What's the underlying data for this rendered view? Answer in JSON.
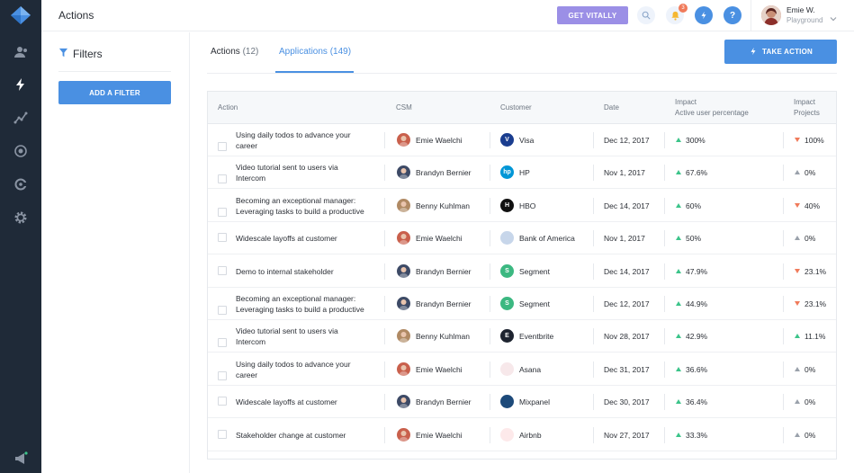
{
  "header": {
    "title": "Actions",
    "get_vitally": "GET VITALLY",
    "notification_count": "3",
    "user": {
      "name": "Emie W.",
      "org": "Playground"
    }
  },
  "nav_icons": [
    "logo-icon",
    "accounts-icon",
    "actions-icon",
    "analytics-icon",
    "target-icon",
    "integrations-icon",
    "settings-icon",
    "announce-icon"
  ],
  "filters": {
    "title": "Filters",
    "add_label": "ADD A FILTER"
  },
  "tabs": [
    {
      "label": "Actions",
      "count": "(12)",
      "active": false
    },
    {
      "label": "Applications",
      "count": "(149)",
      "active": true
    }
  ],
  "take_action_label": "TAKE ACTION",
  "table": {
    "headers": {
      "action": "Action",
      "csm": "CSM",
      "customer": "Customer",
      "date": "Date",
      "impact1_a": "Impact",
      "impact1_b": "Active user percentage",
      "impact2_a": "Impact",
      "impact2_b": "Projects"
    },
    "rows": [
      {
        "action": [
          "Using daily todos to advance your",
          "career"
        ],
        "csm": "Emie Waelchi",
        "customer": "Visa",
        "date": "Dec 12, 2017",
        "impact1": "300%",
        "impact1_dir": "up-g",
        "impact2": "100%",
        "impact2_dir": "dn"
      },
      {
        "action": [
          "Video tutorial sent to users via",
          "Intercom"
        ],
        "csm": "Brandyn Bernier",
        "customer": "HP",
        "date": "Nov 1, 2017",
        "impact1": "67.6%",
        "impact1_dir": "up-g",
        "impact2": "0%",
        "impact2_dir": "up-n"
      },
      {
        "action": [
          "Becoming an exceptional manager:",
          "Leveraging tasks to build a productive"
        ],
        "csm": "Benny Kuhlman",
        "customer": "HBO",
        "date": "Dec 14, 2017",
        "impact1": "60%",
        "impact1_dir": "up-g",
        "impact2": "40%",
        "impact2_dir": "dn"
      },
      {
        "action": [
          "Widescale layoffs at customer"
        ],
        "csm": "Emie Waelchi",
        "customer": "Bank of America",
        "date": "Nov 1, 2017",
        "impact1": "50%",
        "impact1_dir": "up-g",
        "impact2": "0%",
        "impact2_dir": "up-n"
      },
      {
        "action": [
          "Demo to internal stakeholder"
        ],
        "csm": "Brandyn Bernier",
        "customer": "Segment",
        "date": "Dec 14, 2017",
        "impact1": "47.9%",
        "impact1_dir": "up-g",
        "impact2": "23.1%",
        "impact2_dir": "dn"
      },
      {
        "action": [
          "Becoming an exceptional manager:",
          "Leveraging tasks to build a productive"
        ],
        "csm": "Brandyn Bernier",
        "customer": "Segment",
        "date": "Dec 12, 2017",
        "impact1": "44.9%",
        "impact1_dir": "up-g",
        "impact2": "23.1%",
        "impact2_dir": "dn"
      },
      {
        "action": [
          "Video tutorial sent to users via",
          "Intercom"
        ],
        "csm": "Benny Kuhlman",
        "customer": "Eventbrite",
        "date": "Nov 28, 2017",
        "impact1": "42.9%",
        "impact1_dir": "up-g",
        "impact2": "11.1%",
        "impact2_dir": "up-g"
      },
      {
        "action": [
          "Using daily todos to advance your",
          "career"
        ],
        "csm": "Emie Waelchi",
        "customer": "Asana",
        "date": "Dec 31, 2017",
        "impact1": "36.6%",
        "impact1_dir": "up-g",
        "impact2": "0%",
        "impact2_dir": "up-n"
      },
      {
        "action": [
          "Widescale layoffs at customer"
        ],
        "csm": "Brandyn Bernier",
        "customer": "Mixpanel",
        "date": "Dec 30, 2017",
        "impact1": "36.4%",
        "impact1_dir": "up-g",
        "impact2": "0%",
        "impact2_dir": "up-n"
      },
      {
        "action": [
          "Stakeholder change at customer"
        ],
        "csm": "Emie Waelchi",
        "customer": "Airbnb",
        "date": "Nov 27, 2017",
        "impact1": "33.3%",
        "impact1_dir": "up-g",
        "impact2": "0%",
        "impact2_dir": "up-n"
      }
    ]
  },
  "colors": {
    "nav_bg": "#1f2a38",
    "accent": "#4a90e2",
    "vitally": "#9b8fe6",
    "up": "#3cc48a",
    "down": "#f07a5a"
  },
  "csm_colors": {
    "Emie Waelchi": "#c9604c",
    "Brandyn Bernier": "#3d4a66",
    "Benny Kuhlman": "#b08a64"
  },
  "customer_logos": {
    "Visa": {
      "bg": "#1a3d8f",
      "glyph": "V"
    },
    "HP": {
      "bg": "#0096d6",
      "glyph": "hp"
    },
    "HBO": {
      "bg": "#111111",
      "glyph": "H"
    },
    "Bank of America": {
      "bg": "#c7d6ea",
      "glyph": ""
    },
    "Segment": {
      "bg": "#3cb881",
      "glyph": "S"
    },
    "Eventbrite": {
      "bg": "#1e2430",
      "glyph": "E"
    },
    "Asana": {
      "bg": "#f7e8ea",
      "glyph": ""
    },
    "Mixpanel": {
      "bg": "#1d4a7a",
      "glyph": ""
    },
    "Airbnb": {
      "bg": "#fde9ea",
      "glyph": ""
    }
  }
}
